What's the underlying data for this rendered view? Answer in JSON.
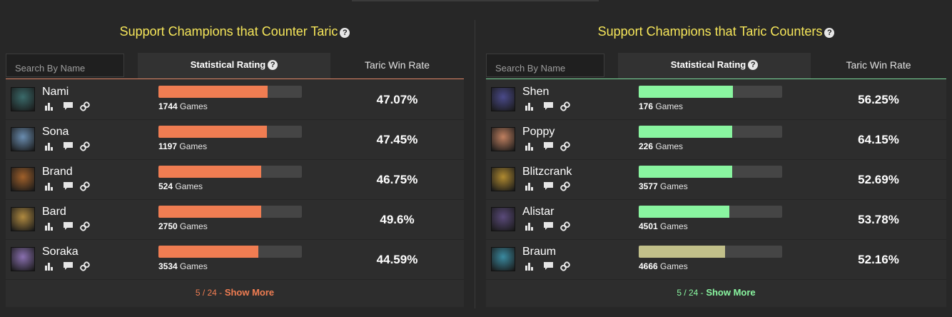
{
  "accent_colors": {
    "title": "#f6e65a",
    "counter_bar": "#f07d52",
    "countered_bar": "#89f5a0",
    "braum_bar": "#c2c08a"
  },
  "left": {
    "title": "Support Champions that Counter Taric",
    "search_placeholder": "Search By Name",
    "col_rating": "Statistical Rating",
    "col_win": "Taric Win Rate",
    "rows": [
      {
        "name": "Nami",
        "games": "1744",
        "games_label": "Games",
        "rate": "47.07%",
        "rating": 0.76,
        "bar_color": "#f07d52",
        "avatar": "#3a6a6a"
      },
      {
        "name": "Sona",
        "games": "1197",
        "games_label": "Games",
        "rate": "47.45%",
        "rating": 0.755,
        "bar_color": "#f07d52",
        "avatar": "#6a8db0"
      },
      {
        "name": "Brand",
        "games": "524",
        "games_label": "Games",
        "rate": "46.75%",
        "rating": 0.715,
        "bar_color": "#f07d52",
        "avatar": "#a0602a"
      },
      {
        "name": "Bard",
        "games": "2750",
        "games_label": "Games",
        "rate": "49.6%",
        "rating": 0.715,
        "bar_color": "#f07d52",
        "avatar": "#b08a40"
      },
      {
        "name": "Soraka",
        "games": "3534",
        "games_label": "Games",
        "rate": "44.59%",
        "rating": 0.695,
        "bar_color": "#f07d52",
        "avatar": "#8a70b0"
      }
    ],
    "footer_count": "5 / 24 -",
    "footer_more": "Show More",
    "footer_color": "#f07d52"
  },
  "right": {
    "title": "Support Champions that Taric Counters",
    "search_placeholder": "Search By Name",
    "col_rating": "Statistical Rating",
    "col_win": "Taric Win Rate",
    "rows": [
      {
        "name": "Shen",
        "games": "176",
        "games_label": "Games",
        "rate": "56.25%",
        "rating": 0.655,
        "bar_color": "#89f5a0",
        "avatar": "#4a4a8a"
      },
      {
        "name": "Poppy",
        "games": "226",
        "games_label": "Games",
        "rate": "64.15%",
        "rating": 0.65,
        "bar_color": "#89f5a0",
        "avatar": "#c08060"
      },
      {
        "name": "Blitzcrank",
        "games": "3577",
        "games_label": "Games",
        "rate": "52.69%",
        "rating": 0.65,
        "bar_color": "#89f5a0",
        "avatar": "#b08a30"
      },
      {
        "name": "Alistar",
        "games": "4501",
        "games_label": "Games",
        "rate": "53.78%",
        "rating": 0.63,
        "bar_color": "#89f5a0",
        "avatar": "#5a4a7a"
      },
      {
        "name": "Braum",
        "games": "4666",
        "games_label": "Games",
        "rate": "52.16%",
        "rating": 0.6,
        "bar_color": "#c2c08a",
        "avatar": "#3a8aa0"
      }
    ],
    "footer_count": "5 / 24 -",
    "footer_more": "Show More",
    "footer_color": "#89f5a0"
  },
  "row_icons": [
    "stats-icon",
    "comment-icon",
    "link-icon"
  ]
}
